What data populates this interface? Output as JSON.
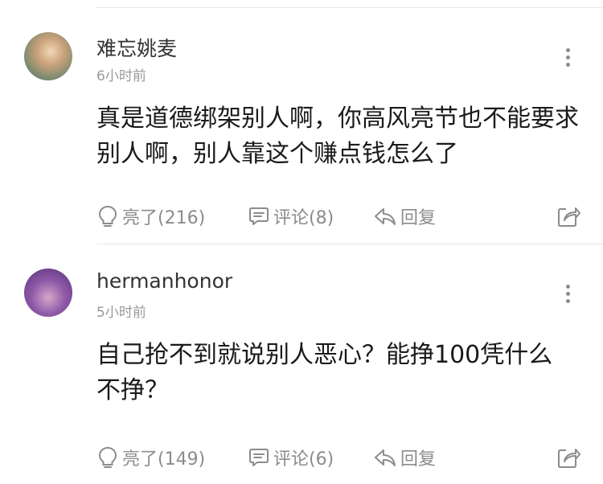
{
  "comments": [
    {
      "username": "难忘姚麦",
      "time": "6小时前",
      "content": "真是道德绑架别人啊，你高风亮节也不能要求别人啊，别人靠这个赚点钱怎么了",
      "like_label": "亮了(216)",
      "comment_label": "评论(8)",
      "reply_label": "回复"
    },
    {
      "username": "hermanhonor",
      "time": "5小时前",
      "content": "自己抢不到就说别人恶心？能挣100凭什么不挣？",
      "like_label": "亮了(149)",
      "comment_label": "评论(6)",
      "reply_label": "回复"
    }
  ]
}
